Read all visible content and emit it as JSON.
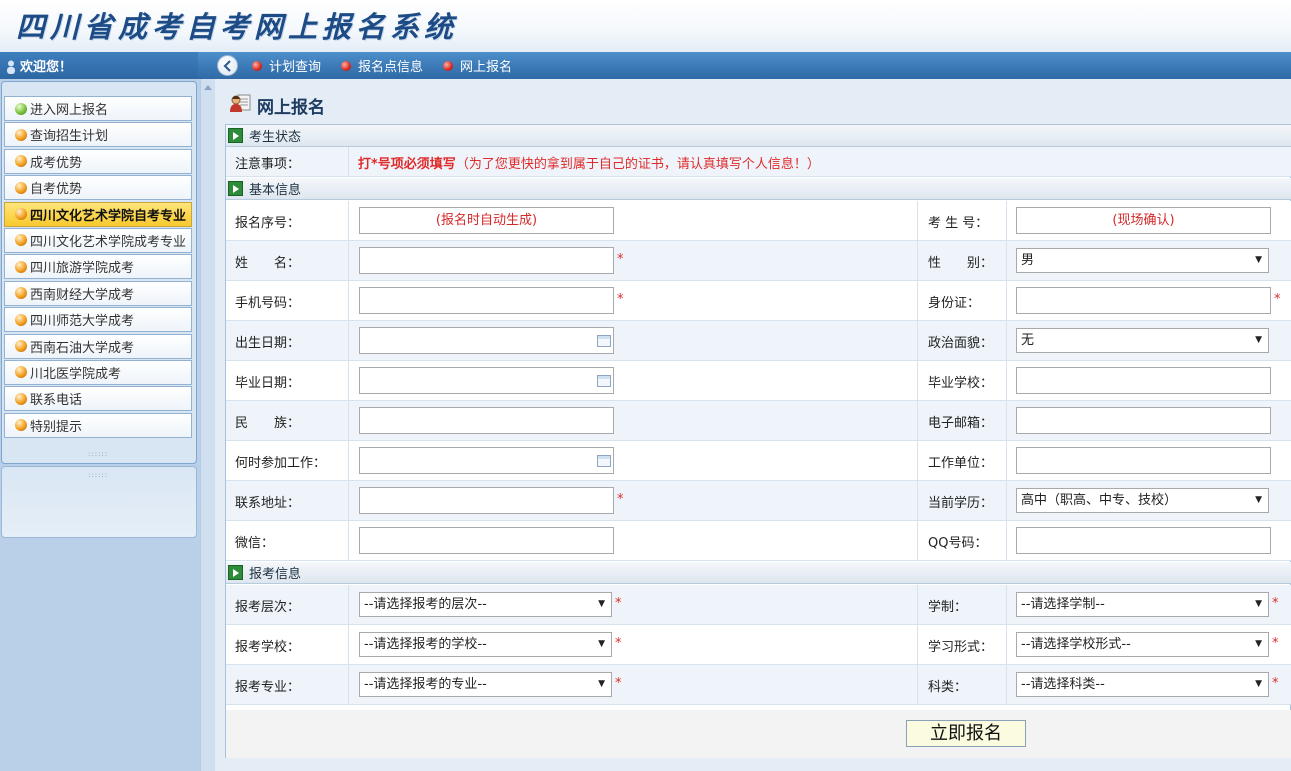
{
  "header": {
    "title": "四川省成考自考网上报名系统"
  },
  "topbar": {
    "welcome": "欢迎您！",
    "nav": [
      {
        "label": "计划查询",
        "icon": "red-dot-icon"
      },
      {
        "label": "报名点信息",
        "icon": "red-dot-icon"
      },
      {
        "label": "网上报名",
        "icon": "red-dot-icon"
      }
    ]
  },
  "sidebar": {
    "items": [
      {
        "label": "进入网上报名",
        "ball": "green",
        "active": false
      },
      {
        "label": "查询招生计划",
        "ball": "orange",
        "active": false
      },
      {
        "label": "成考优势",
        "ball": "orange",
        "active": false
      },
      {
        "label": "自考优势",
        "ball": "orange",
        "active": false
      },
      {
        "label": "四川文化艺术学院自考专业",
        "ball": "orange",
        "active": true
      },
      {
        "label": "四川文化艺术学院成考专业",
        "ball": "orange",
        "active": false
      },
      {
        "label": "四川旅游学院成考",
        "ball": "orange",
        "active": false
      },
      {
        "label": "西南财经大学成考",
        "ball": "orange",
        "active": false
      },
      {
        "label": "四川师范大学成考",
        "ball": "orange",
        "active": false
      },
      {
        "label": "西南石油大学成考",
        "ball": "orange",
        "active": false
      },
      {
        "label": "川北医学院成考",
        "ball": "orange",
        "active": false
      },
      {
        "label": "联系电话",
        "ball": "orange",
        "active": false
      },
      {
        "label": "特别提示",
        "ball": "orange",
        "active": false
      }
    ]
  },
  "main": {
    "title": "网上报名",
    "sections": {
      "status": "考生状态",
      "basic": "基本信息",
      "exam": "报考信息"
    },
    "notice": {
      "label": "注意事项：",
      "strong": "打*号项必须填写",
      "rest": "（为了您更快的拿到属于自己的证书，请认真填写个人信息！）"
    },
    "fields": {
      "reg_no_label": "报名序号：",
      "reg_no_value": "(报名时自动生成)",
      "exam_no_label": "考 生 号：",
      "exam_no_value": "(现场确认)",
      "name_label": "姓　　名：",
      "gender_label": "性　　别：",
      "gender_value": "男",
      "phone_label": "手机号码：",
      "id_label": "身份证：",
      "birth_label": "出生日期：",
      "politics_label": "政治面貌：",
      "politics_value": "无",
      "grad_date_label": "毕业日期：",
      "grad_school_label": "毕业学校：",
      "ethnic_label": "民　　族：",
      "email_label": "电子邮箱：",
      "work_start_label": "何时参加工作：",
      "employer_label": "工作单位：",
      "address_label": "联系地址：",
      "education_label": "当前学历：",
      "education_value": "高中（职高、中专、技校）",
      "wechat_label": "微信：",
      "qq_label": "QQ号码："
    },
    "exam_fields": {
      "level_label": "报考层次：",
      "level_value": "--请选择报考的层次--",
      "duration_label": "学制：",
      "duration_value": "--请选择学制--",
      "school_label": "报考学校：",
      "school_value": "--请选择报考的学校--",
      "form_label": "学习形式：",
      "form_value": "--请选择学校形式--",
      "major_label": "报考专业：",
      "major_value": "--请选择报考的专业--",
      "category_label": "科类：",
      "category_value": "--请选择科类--"
    },
    "required_mark": "*",
    "submit": "立即报名"
  }
}
